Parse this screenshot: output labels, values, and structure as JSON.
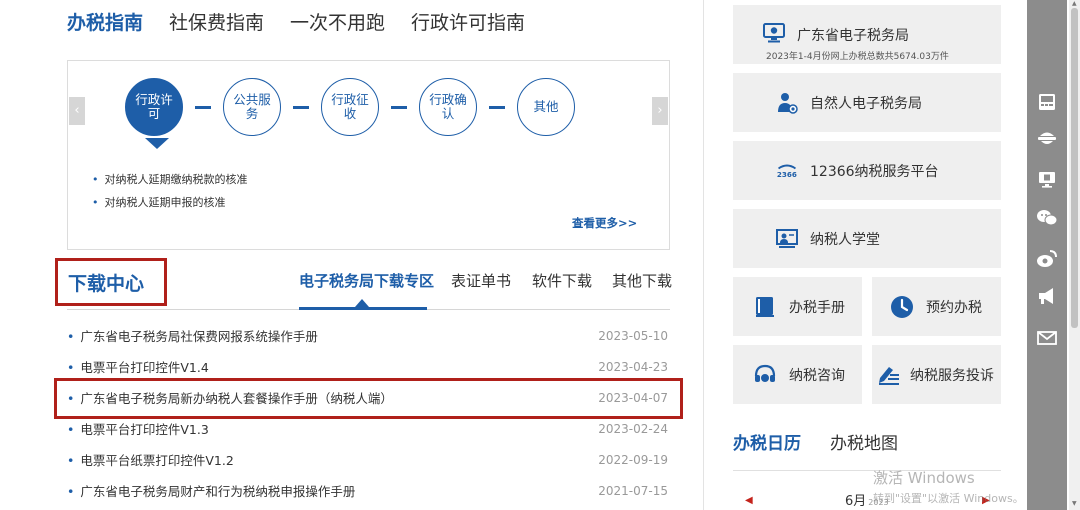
{
  "guide_tabs": [
    "办税指南",
    "社保费指南",
    "一次不用跑",
    "行政许可指南"
  ],
  "process": {
    "steps": [
      "行政许可",
      "公共服务",
      "行政征收",
      "行政确认",
      "其他"
    ],
    "items": [
      "对纳税人延期缴纳税款的核准",
      "对纳税人延期申报的核准"
    ],
    "see_more": "查看更多>>"
  },
  "download": {
    "title": "下载中心",
    "tabs": [
      "电子税务局下载专区",
      "表证单书",
      "软件下载",
      "其他下载"
    ],
    "files": [
      {
        "name": "广东省电子税务局社保费网报系统操作手册",
        "date": "2023-05-10"
      },
      {
        "name": "电票平台打印控件V1.4",
        "date": "2023-04-23"
      },
      {
        "name": "广东省电子税务局新办纳税人套餐操作手册（纳税人端）",
        "date": "2023-04-07"
      },
      {
        "name": "电票平台打印控件V1.3",
        "date": "2023-02-24"
      },
      {
        "name": "电票平台纸票打印控件V1.2",
        "date": "2022-09-19"
      },
      {
        "name": "广东省电子税务局财产和行为税纳税申报操作手册",
        "date": "2021-07-15"
      }
    ]
  },
  "services": {
    "etax": {
      "label": "广东省电子税务局",
      "sub": "2023年1-4月份网上办税总数共5674.03万件",
      "icon": "monitor-icon"
    },
    "natural_person": {
      "label": "自然人电子税务局",
      "icon": "person-icon"
    },
    "hotline": {
      "label": "12366纳税服务平台",
      "icon": "12366-logo-icon"
    },
    "school": {
      "label": "纳税人学堂",
      "icon": "classroom-icon"
    },
    "manual": {
      "label": "办税手册",
      "icon": "book-icon"
    },
    "appointment": {
      "label": "预约办税",
      "icon": "clock-icon"
    },
    "consult": {
      "label": "纳税咨询",
      "icon": "headset-icon"
    },
    "complaint": {
      "label": "纳税服务投诉",
      "icon": "pen-icon"
    }
  },
  "calendar": {
    "tabs": [
      "办税日历",
      "办税地图"
    ],
    "month": "6月",
    "year": "2023"
  },
  "watermark": {
    "line1": "激活 Windows",
    "line2": "转到\"设置\"以激活 Windows。"
  },
  "toolbar_icons": [
    "terminal-icon",
    "police-icon",
    "monitor-icon",
    "wechat-icon",
    "weibo-icon",
    "megaphone-icon",
    "mail-icon"
  ],
  "colors": {
    "brand": "#1e5ea8",
    "highlight": "#b0201a",
    "card_bg": "#efefef",
    "toolbar": "#8c8c8c"
  }
}
